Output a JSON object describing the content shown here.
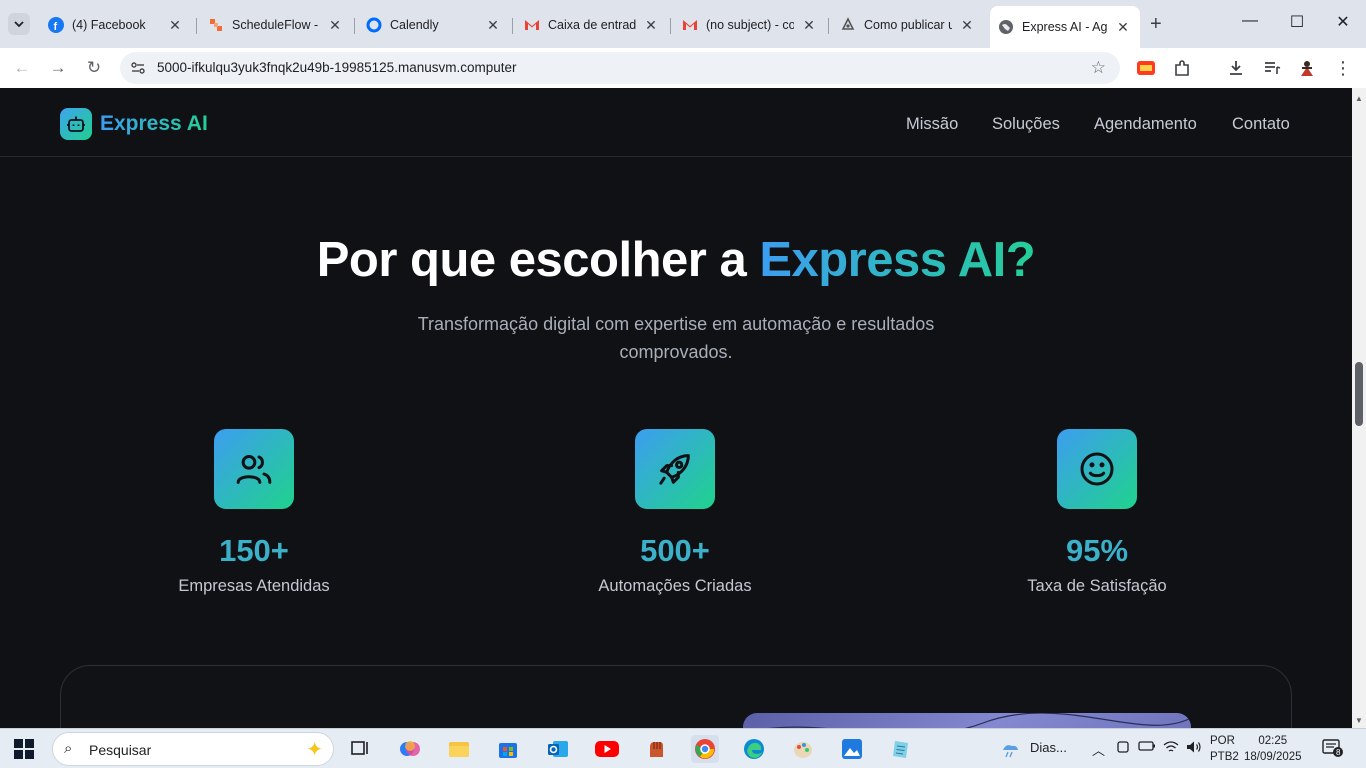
{
  "browser": {
    "tabs": [
      {
        "title": "(4) Facebook",
        "icon": "facebook-icon"
      },
      {
        "title": "ScheduleFlow - I",
        "icon": "scheduleflow-icon"
      },
      {
        "title": "Calendly",
        "icon": "calendly-icon"
      },
      {
        "title": "Caixa de entrada",
        "icon": "gmail-icon"
      },
      {
        "title": "(no subject) - co",
        "icon": "gmail-icon"
      },
      {
        "title": "Como publicar u",
        "icon": "site-icon"
      },
      {
        "title": "Express AI - Age",
        "icon": "globe-icon"
      }
    ],
    "active_tab": 6,
    "url": "5000-ifkulqu3yuk3fnqk2u49b-19985125.manusvm.computer"
  },
  "site": {
    "logo_text": "Express AI",
    "nav": [
      "Missão",
      "Soluções",
      "Agendamento",
      "Contato"
    ],
    "hero": {
      "title_plain": "Por que escolher a ",
      "title_highlight": "Express AI?",
      "subtitle": "Transformação digital com expertise em automação e resultados comprovados."
    },
    "stats": [
      {
        "value": "150+",
        "label": "Empresas Atendidas",
        "icon": "users-icon"
      },
      {
        "value": "500+",
        "label": "Automações Criadas",
        "icon": "rocket-icon"
      },
      {
        "value": "95%",
        "label": "Taxa de Satisfação",
        "icon": "smile-icon"
      }
    ],
    "colors": {
      "gradient_start": "#3d9df0",
      "gradient_end": "#24cf98",
      "background": "#0f1115"
    }
  },
  "taskbar": {
    "search_placeholder": "Pesquisar",
    "weather": "Dias...",
    "lang_top": "POR",
    "lang_bottom": "PTB2",
    "time": "02:25",
    "date": "18/09/2025",
    "notifications": "8"
  }
}
